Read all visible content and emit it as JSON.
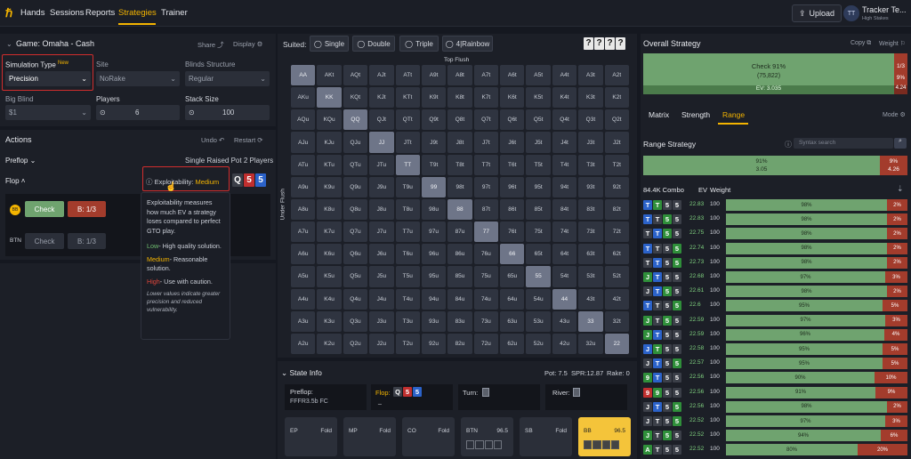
{
  "nav": {
    "items": [
      "Hands",
      "Sessions",
      "Reports",
      "Strategies",
      "Trainer"
    ],
    "active": "Strategies",
    "upload": "Upload",
    "user_initials": "TT",
    "user_name": "Tracker Te...",
    "user_sub": "High Stakes"
  },
  "left": {
    "game_title": "Game: Omaha - Cash",
    "share": "Share",
    "display": "Display",
    "sim_type_label": "Simulation Type",
    "sim_type_badge": "New",
    "sim_type_value": "Precision",
    "site_label": "Site",
    "site_value": "NoRake",
    "blinds_label": "Blinds Structure",
    "blinds_value": "Regular",
    "bb_label": "Big Blind",
    "bb_value": "$1",
    "players_label": "Players",
    "players_value": "6",
    "stack_label": "Stack Size",
    "stack_value": "100",
    "actions_title": "Actions",
    "undo": "Undo",
    "restart": "Restart",
    "preflop": "Preflop",
    "preflop_desc": "Single Raised Pot 2 Players",
    "flop": "Flop",
    "exploit_label": "Exploitability:",
    "exploit_value": "Medium",
    "flop_cards": [
      "Q",
      "5",
      "5"
    ],
    "bb_pos": "BB",
    "check": "Check",
    "bet": "B: 1/3",
    "btn_pos": "BTN",
    "tooltip": {
      "main": "Exploitability measures how much EV a strategy loses compared to perfect GTO play.",
      "low_k": "Low",
      "low_v": "- High quality solution.",
      "med_k": "Medium",
      "med_v": "- Reasonable solution.",
      "high_k": "High",
      "high_v": "- Use with caution.",
      "foot": "Lower values indicate greater precision and reduced vulnerability."
    }
  },
  "center": {
    "suited_label": "Suited:",
    "suited_opts": [
      "Single",
      "Double",
      "Triple",
      "4|Rainbow"
    ],
    "q_cards": [
      "?",
      "?",
      "?",
      "?"
    ],
    "top_label": "Top Flush",
    "side_label": "Under Flush",
    "ranks": [
      "A",
      "K",
      "Q",
      "J",
      "T",
      "9",
      "8",
      "7",
      "6",
      "5",
      "4",
      "3",
      "2"
    ],
    "state_title": "State Info",
    "pot": "Pot: 7.5",
    "spr": "SPR:12.87",
    "rake": "Rake: 0",
    "preflop_label": "Preflop:",
    "preflop_line": "FFFR3.5b FC",
    "flop_label": "Flop:",
    "flop_cards": [
      "Q",
      "5",
      "5"
    ],
    "flop_dash": "_",
    "turn_label": "Turn:",
    "river_label": "River:",
    "positions": [
      {
        "pos": "EP",
        "act": "Fold"
      },
      {
        "pos": "MP",
        "act": "Fold"
      },
      {
        "pos": "CO",
        "act": "Fold"
      },
      {
        "pos": "BTN",
        "act": "96.5"
      },
      {
        "pos": "SB",
        "act": "Fold"
      },
      {
        "pos": "BB",
        "act": "96.5"
      }
    ]
  },
  "right": {
    "overall_title": "Overall Strategy",
    "copy": "Copy",
    "weight": "Weight",
    "check_pct": "Check 91%",
    "check_combos": "(75,822)",
    "side_frac": "1/3",
    "side_pct": "9%",
    "ev": "EV: 3.035",
    "ev_side": "4.24",
    "tabs": [
      "Matrix",
      "Strength",
      "Range"
    ],
    "active_tab": "Range",
    "mode": "Mode",
    "range_title": "Range Strategy",
    "search_placeholder": "Syntax search",
    "range_g1": "91%",
    "range_g2": "3.05",
    "range_r1": "9%",
    "range_r2": "4.26",
    "col_combo": "84.4K Combo",
    "col_ev": "EV",
    "col_weight": "Weight",
    "rows": [
      {
        "cards": [
          "T",
          "T",
          "5",
          "5"
        ],
        "cols": [
          "blue",
          "green",
          "gray",
          "gray"
        ],
        "ev": "22.83",
        "w": "100",
        "g": "98%",
        "r": "2%",
        "gp": 98
      },
      {
        "cards": [
          "T",
          "T",
          "5",
          "5"
        ],
        "cols": [
          "blue",
          "gray",
          "green",
          "gray"
        ],
        "ev": "22.83",
        "w": "100",
        "g": "98%",
        "r": "2%",
        "gp": 98
      },
      {
        "cards": [
          "T",
          "T",
          "5",
          "5"
        ],
        "cols": [
          "gray",
          "blue",
          "green",
          "gray"
        ],
        "ev": "22.75",
        "w": "100",
        "g": "98%",
        "r": "2%",
        "gp": 98
      },
      {
        "cards": [
          "T",
          "T",
          "5",
          "5"
        ],
        "cols": [
          "blue",
          "gray",
          "gray",
          "green"
        ],
        "ev": "22.74",
        "w": "100",
        "g": "98%",
        "r": "2%",
        "gp": 98
      },
      {
        "cards": [
          "T",
          "T",
          "5",
          "5"
        ],
        "cols": [
          "gray",
          "blue",
          "gray",
          "green"
        ],
        "ev": "22.73",
        "w": "100",
        "g": "98%",
        "r": "2%",
        "gp": 98
      },
      {
        "cards": [
          "J",
          "T",
          "5",
          "5"
        ],
        "cols": [
          "green",
          "blue",
          "gray",
          "gray"
        ],
        "ev": "22.68",
        "w": "100",
        "g": "97%",
        "r": "3%",
        "gp": 97
      },
      {
        "cards": [
          "J",
          "T",
          "5",
          "5"
        ],
        "cols": [
          "gray",
          "blue",
          "green",
          "gray"
        ],
        "ev": "22.61",
        "w": "100",
        "g": "98%",
        "r": "2%",
        "gp": 98
      },
      {
        "cards": [
          "T",
          "T",
          "5",
          "5"
        ],
        "cols": [
          "blue",
          "gray",
          "gray",
          "green"
        ],
        "ev": "22.6",
        "w": "100",
        "g": "95%",
        "r": "5%",
        "gp": 95
      },
      {
        "cards": [
          "J",
          "T",
          "5",
          "5"
        ],
        "cols": [
          "green",
          "gray",
          "green",
          "gray"
        ],
        "ev": "22.59",
        "w": "100",
        "g": "97%",
        "r": "3%",
        "gp": 97
      },
      {
        "cards": [
          "J",
          "T",
          "5",
          "5"
        ],
        "cols": [
          "green",
          "blue",
          "gray",
          "gray"
        ],
        "ev": "22.59",
        "w": "100",
        "g": "96%",
        "r": "4%",
        "gp": 96
      },
      {
        "cards": [
          "J",
          "T",
          "5",
          "5"
        ],
        "cols": [
          "blue",
          "green",
          "gray",
          "gray"
        ],
        "ev": "22.58",
        "w": "100",
        "g": "95%",
        "r": "5%",
        "gp": 95
      },
      {
        "cards": [
          "J",
          "T",
          "5",
          "5"
        ],
        "cols": [
          "gray",
          "blue",
          "gray",
          "green"
        ],
        "ev": "22.57",
        "w": "100",
        "g": "95%",
        "r": "5%",
        "gp": 95
      },
      {
        "cards": [
          "9",
          "T",
          "5",
          "5"
        ],
        "cols": [
          "green",
          "blue",
          "gray",
          "gray"
        ],
        "ev": "22.56",
        "w": "100",
        "g": "90%",
        "r": "10%",
        "gp": 90
      },
      {
        "cards": [
          "9",
          "9",
          "5",
          "5"
        ],
        "cols": [
          "red",
          "green",
          "gray",
          "gray"
        ],
        "ev": "22.56",
        "w": "100",
        "g": "91%",
        "r": "9%",
        "gp": 91
      },
      {
        "cards": [
          "J",
          "T",
          "5",
          "5"
        ],
        "cols": [
          "gray",
          "blue",
          "gray",
          "green"
        ],
        "ev": "22.56",
        "w": "100",
        "g": "98%",
        "r": "2%",
        "gp": 98
      },
      {
        "cards": [
          "J",
          "T",
          "5",
          "5"
        ],
        "cols": [
          "gray",
          "gray",
          "gray",
          "green"
        ],
        "ev": "22.52",
        "w": "100",
        "g": "97%",
        "r": "3%",
        "gp": 97
      },
      {
        "cards": [
          "J",
          "T",
          "5",
          "5"
        ],
        "cols": [
          "green",
          "gray",
          "green",
          "gray"
        ],
        "ev": "22.52",
        "w": "100",
        "g": "94%",
        "r": "6%",
        "gp": 94
      },
      {
        "cards": [
          "A",
          "T",
          "5",
          "5"
        ],
        "cols": [
          "green",
          "gray",
          "gray",
          "gray"
        ],
        "ev": "22.52",
        "w": "100",
        "g": "80%",
        "r": "20%",
        "gp": 80
      }
    ]
  },
  "colors": {
    "accent": "#f4b400",
    "red": "#d12d2d",
    "green": "#6fa36f",
    "bet": "#a33c2c"
  }
}
